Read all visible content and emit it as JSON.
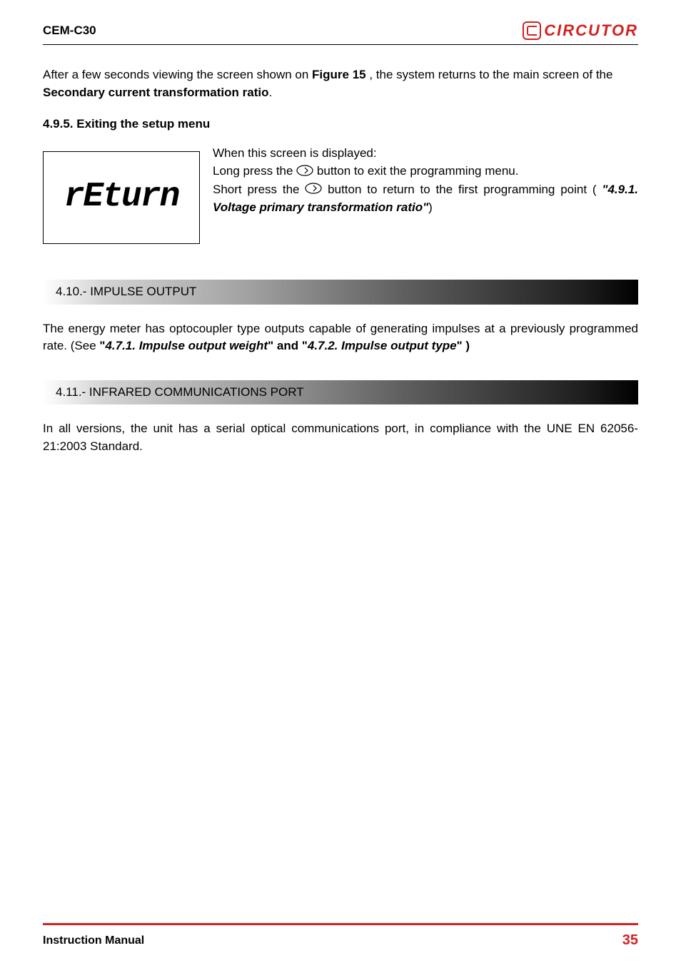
{
  "header": {
    "model": "CEM-C30",
    "brand": "CIRCUTOR"
  },
  "intro": {
    "part1": "After a few seconds viewing the screen shown on ",
    "figure": "Figure 15 ",
    "part2": ", the system returns to the main screen of the ",
    "part3": "Secondary current transformation ratio",
    "part4": "."
  },
  "section_495": {
    "title": "4.9.5. Exiting the setup menu",
    "lcd": "rEturn",
    "line1": "When this screen is displayed:",
    "line2a": "Long press the ",
    "line2b": " button to exit the programming menu.",
    "line3a": "Short press the ",
    "line3b": " button to return to the first programming point ( ",
    "line3ref": "\"4.9.1. Voltage primary transformation ratio\"",
    "line3c": ")"
  },
  "section_410": {
    "header": "4.10.- IMPULSE OUTPUT",
    "body1": "The energy meter has optocoupler type outputs capable of generating impulses at a previously programmed rate. (See ",
    "quote1": "\"",
    "ref1": "4.7.1. Impulse output weight",
    "mid": "\" and \"",
    "ref2": "4.7.2. Impulse output type",
    "end": "\" )"
  },
  "section_411": {
    "header": "4.11.- INFRARED COMMUNICATIONS PORT",
    "body": " In all versions, the unit has a serial optical communications port, in compliance with the UNE EN 62056-21:2003 Standard."
  },
  "footer": {
    "title": "Instruction Manual",
    "page": "35"
  }
}
